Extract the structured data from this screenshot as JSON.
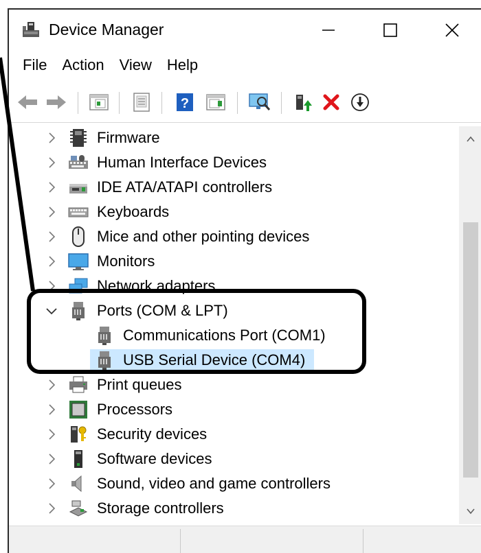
{
  "window": {
    "title": "Device Manager",
    "app_icon": "device-manager-icon",
    "controls": {
      "minimize": "minimize-icon",
      "maximize": "maximize-icon",
      "close": "close-icon"
    }
  },
  "menu": {
    "items": [
      {
        "label": "File"
      },
      {
        "label": "Action"
      },
      {
        "label": "View"
      },
      {
        "label": "Help"
      }
    ]
  },
  "toolbar": {
    "icons": [
      "back-arrow-icon",
      "forward-arrow-icon",
      "show-hide-console-tree-icon",
      "properties-icon",
      "help-icon",
      "action-pane-icon",
      "scan-hardware-changes-icon",
      "update-driver-icon",
      "uninstall-device-icon",
      "disable-device-icon"
    ],
    "colors": {
      "help": "#1e5fbf",
      "uninstall": "#e0161b",
      "update": "#1a9a2c"
    }
  },
  "tree": {
    "items": [
      {
        "label": "Firmware",
        "icon": "firmware-icon",
        "expanded": false
      },
      {
        "label": "Human Interface Devices",
        "icon": "hid-icon",
        "expanded": false
      },
      {
        "label": "IDE ATA/ATAPI controllers",
        "icon": "ide-controller-icon",
        "expanded": false
      },
      {
        "label": "Keyboards",
        "icon": "keyboard-icon",
        "expanded": false
      },
      {
        "label": "Mice and other pointing devices",
        "icon": "mouse-icon",
        "expanded": false
      },
      {
        "label": "Monitors",
        "icon": "monitor-icon",
        "expanded": false
      },
      {
        "label": "Network adapters",
        "icon": "network-adapter-icon",
        "expanded": false
      },
      {
        "label": "Ports (COM & LPT)",
        "icon": "port-icon",
        "expanded": true
      },
      {
        "label": "Communications Port (COM1)",
        "icon": "port-icon",
        "child": true
      },
      {
        "label": "USB Serial Device (COM4)",
        "icon": "port-icon",
        "child": true,
        "selected": true
      },
      {
        "label": "Print queues",
        "icon": "printer-icon",
        "expanded": false
      },
      {
        "label": "Processors",
        "icon": "processor-icon",
        "expanded": false
      },
      {
        "label": "Security devices",
        "icon": "security-device-icon",
        "expanded": false
      },
      {
        "label": "Software devices",
        "icon": "software-device-icon",
        "expanded": false
      },
      {
        "label": "Sound, video and game controllers",
        "icon": "speaker-icon",
        "expanded": false
      },
      {
        "label": "Storage controllers",
        "icon": "storage-controller-icon",
        "expanded": false
      }
    ],
    "selection_color": "#cce8ff"
  },
  "annotation": {
    "color": "#000000",
    "note": "highlight box around Ports (COM & LPT) group"
  }
}
